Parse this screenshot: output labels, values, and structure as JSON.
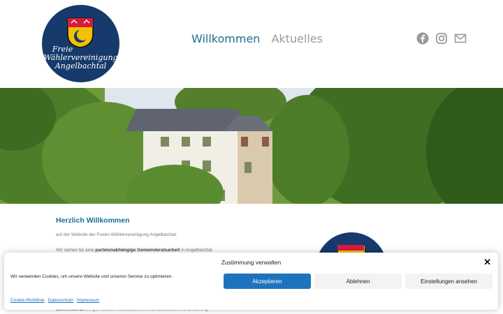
{
  "logo": {
    "line1": "Freie",
    "line2": "Wählervereinigung",
    "line3": "Angelbachtal"
  },
  "nav": {
    "items": [
      {
        "label": "Willkommen",
        "active": true
      },
      {
        "label": "Aktuelles",
        "active": false
      }
    ]
  },
  "social": {
    "icons": [
      "facebook-icon",
      "instagram-icon",
      "mail-icon"
    ],
    "color": "#9a9a9a"
  },
  "content": {
    "heading": "Herzlich Willkommen",
    "intro": "auf der Website der Freien Wählervereinigung Angelbachtal.",
    "line2_prefix": "Wir stehen für eine ",
    "line2_bold": "parteiunabhängige Gemeinderatsarbeit",
    "line2_suffix": " in Angelbachtal.",
    "lower_bold": "Gemeinderat",
    "lower_text": " bringen unsere Kandidatinnen und Kandidaten viel Erfahrung"
  },
  "cookie_banner": {
    "title": "Zustimmung verwalten",
    "message": "Wir verwenden Cookies, um unsere Website und unseren Service zu optimieren.",
    "accept_label": "Akzeptieren",
    "deny_label": "Ablehnen",
    "settings_label": "Einstellungen ansehen",
    "links": [
      "Cookie-Richtlinie",
      "Datenschutz",
      "Impressum"
    ],
    "accent_color": "#1e73be"
  },
  "colors": {
    "brand_blue": "#153a6b",
    "nav_active": "#1f6e90",
    "heading": "#1a6b9a"
  }
}
